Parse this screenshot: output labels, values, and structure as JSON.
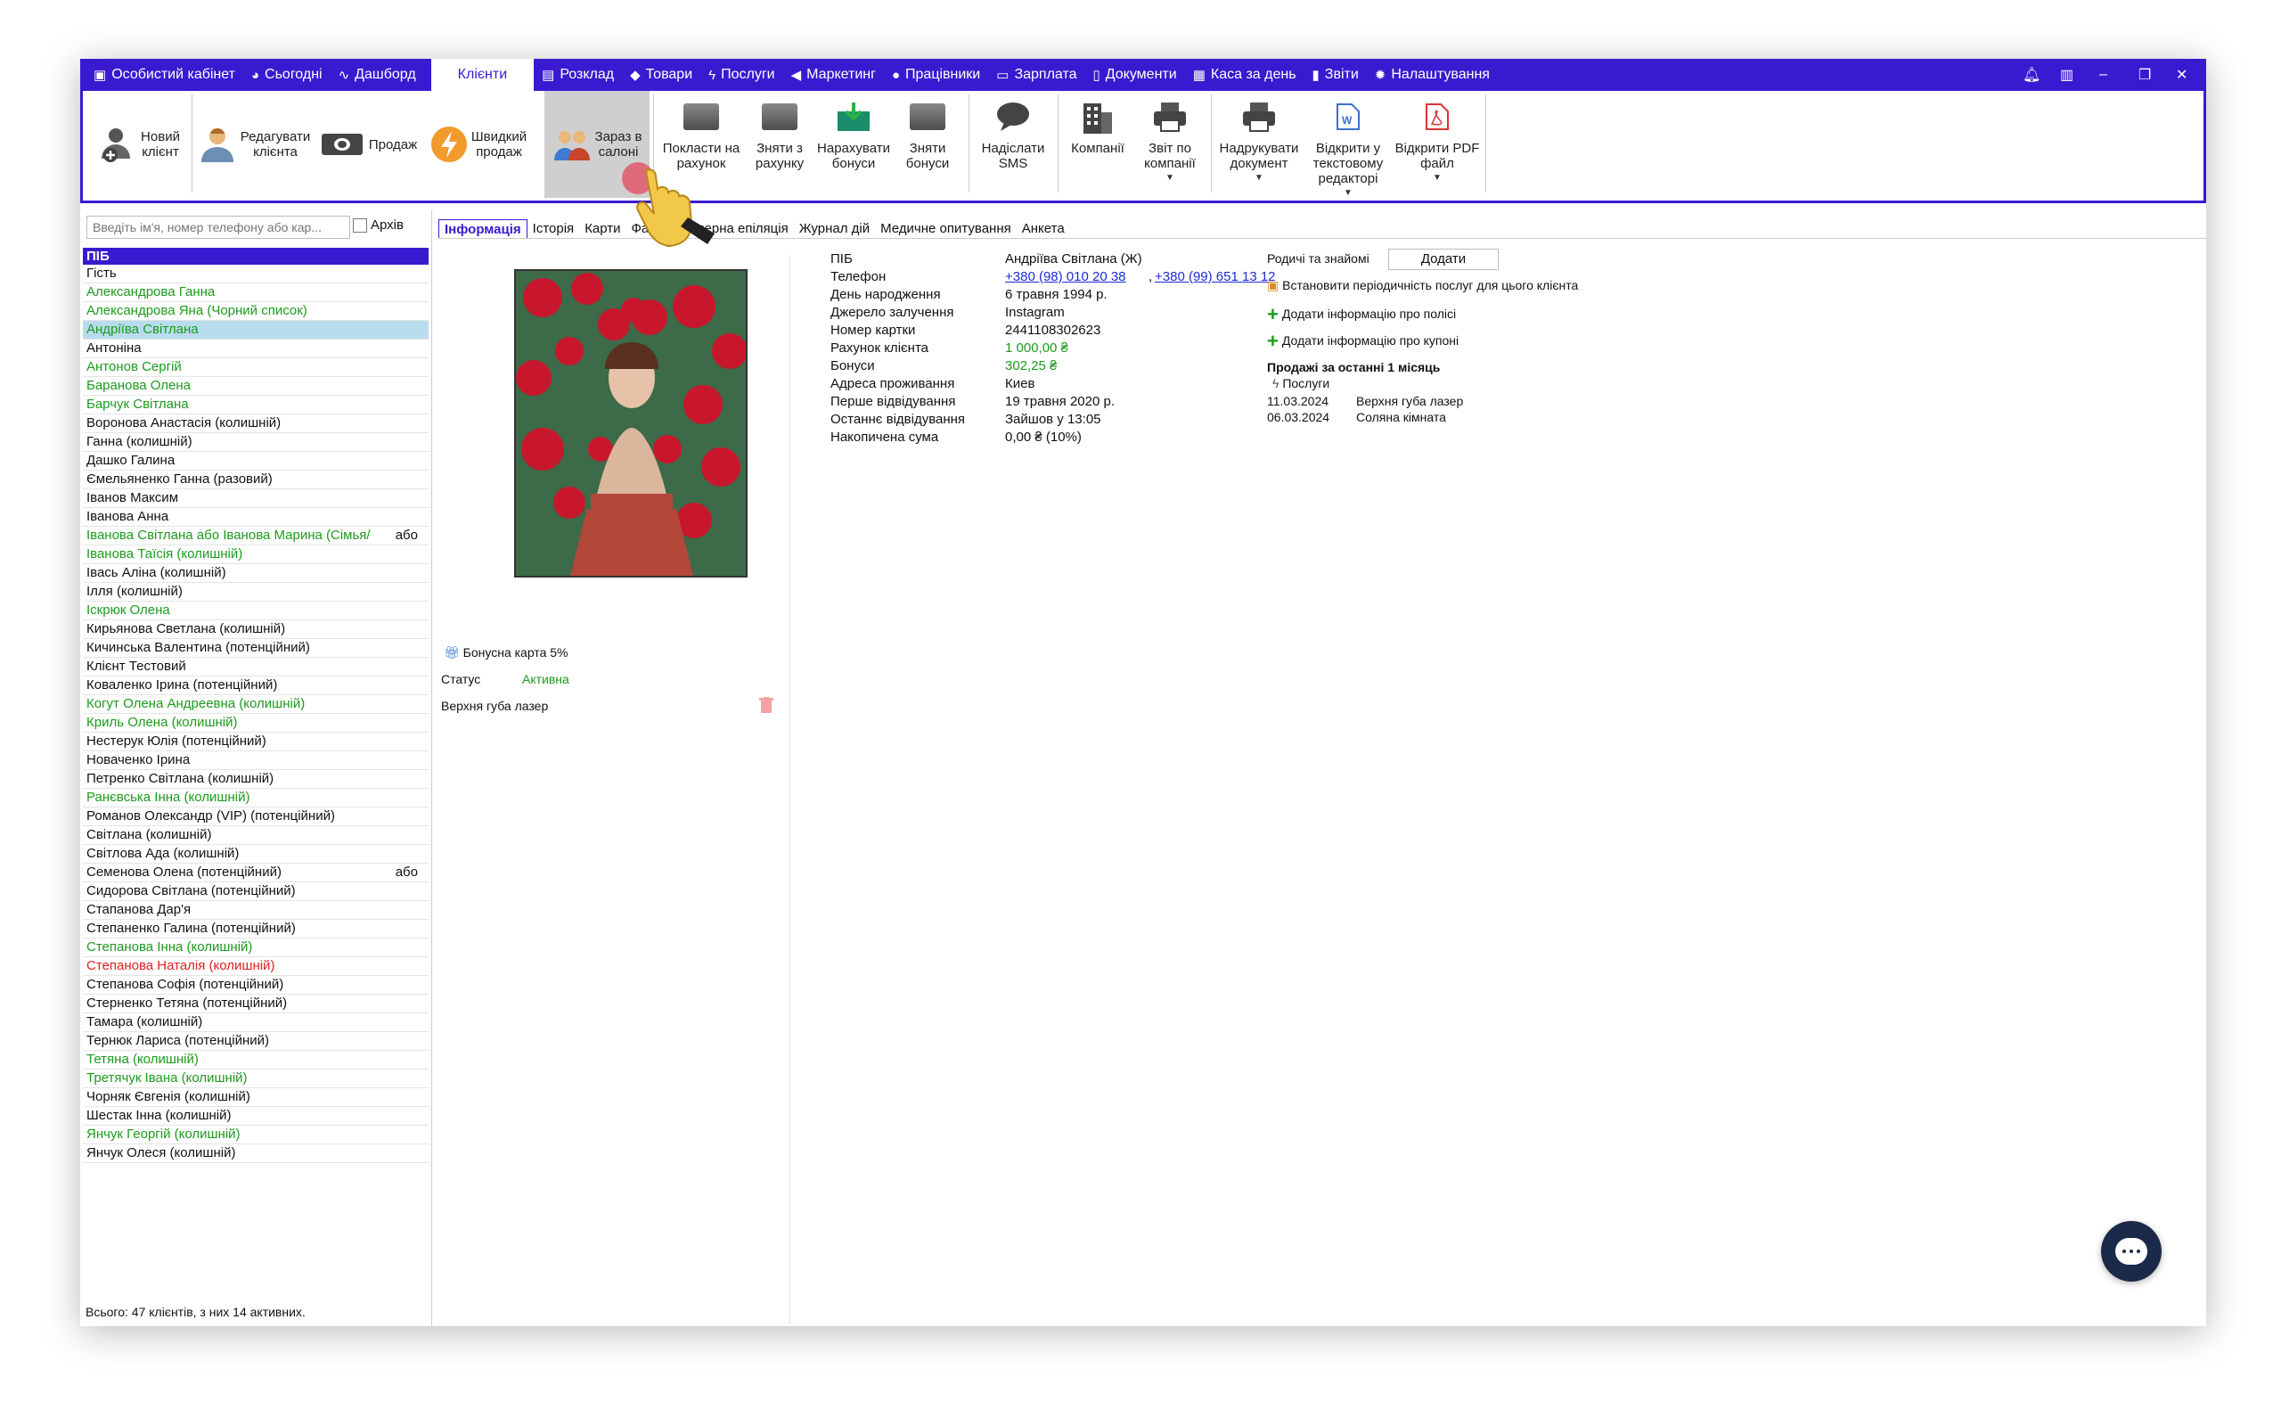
{
  "topbar": {
    "items": [
      {
        "label": "Особистий кабінет",
        "icon": "wallet-icon"
      },
      {
        "label": "Сьогодні",
        "icon": "clock-icon"
      },
      {
        "label": "Дашборд",
        "icon": "pulse-icon"
      },
      {
        "label": "Клієнти",
        "icon": "",
        "active": true
      },
      {
        "label": "Розклад",
        "icon": "calendar-icon"
      },
      {
        "label": "Товари",
        "icon": "box-icon"
      },
      {
        "label": "Послуги",
        "icon": "bolt-icon"
      },
      {
        "label": "Маркетинг",
        "icon": "megaphone-icon"
      },
      {
        "label": "Працівники",
        "icon": "person-icon"
      },
      {
        "label": "Зарплата",
        "icon": "money-icon"
      },
      {
        "label": "Документи",
        "icon": "document-icon"
      },
      {
        "label": "Каса за день",
        "icon": "calculator-icon"
      },
      {
        "label": "Звіти",
        "icon": "bar-chart-icon"
      },
      {
        "label": "Налаштування",
        "icon": "gear-icon"
      }
    ]
  },
  "ribbon": {
    "new_client": "Новий\nклієнт",
    "edit_client": "Редагувати\nклієнта",
    "sale": "Продаж",
    "quick_sale": "Швидкий\nпродаж",
    "now_in_salon": "Зараз в\nсалоні",
    "deposit": "Покласти на\nрахунок",
    "withdraw": "Зняти з\nрахунку",
    "add_bonus": "Нарахувати\nбонуси",
    "remove_bonus": "Зняти\nбонуси",
    "send_sms": "Надіслати\nSMS",
    "companies": "Компанії",
    "company_report": "Звіт по\nкомпанії",
    "print_doc": "Надрукувати\nдокумент",
    "open_text": "Відкрити у\nтекстовому\nредакторі",
    "open_pdf": "Відкрити PDF\nфайл"
  },
  "left": {
    "search_placeholder": "Введіть ім'я, номер телефону або кар...",
    "archive_label": "Архів",
    "header": "ПІБ",
    "footer": "Всього: 47 клієнтів, з них 14 активних.",
    "clients": [
      {
        "name": "Гість",
        "color": "black"
      },
      {
        "name": "Александрова Ганна",
        "color": "green"
      },
      {
        "name": "Александрова Яна (Чорний список)",
        "color": "green"
      },
      {
        "name": "Андріїва Світлана",
        "color": "green",
        "selected": true
      },
      {
        "name": "Антоніна",
        "color": "black"
      },
      {
        "name": "Антонов Сергій",
        "color": "green"
      },
      {
        "name": "Баранова Олена",
        "color": "green"
      },
      {
        "name": "Барчук Світлана",
        "color": "green"
      },
      {
        "name": "Воронова Анастасія (колишній)",
        "color": "black"
      },
      {
        "name": "Ганна (колишній)",
        "color": "black"
      },
      {
        "name": "Дашко Галина",
        "color": "black"
      },
      {
        "name": "Ємельяненко Ганна (разовий)",
        "color": "black"
      },
      {
        "name": "Іванов Максим",
        "color": "black"
      },
      {
        "name": "Іванова Анна",
        "color": "black"
      },
      {
        "name": "Іванова Світлана  або Іванова  Марина (Сімья/",
        "color": "green",
        "tag": "або"
      },
      {
        "name": "Іванова Таїсія (колишній)",
        "color": "green"
      },
      {
        "name": "Івась Аліна (колишній)",
        "color": "black"
      },
      {
        "name": "Ілля (колишній)",
        "color": "black"
      },
      {
        "name": "Іскрюк Олена",
        "color": "green"
      },
      {
        "name": "Кирьянова Светлана (колишній)",
        "color": "black"
      },
      {
        "name": "Кичинська Валентина (потенційний)",
        "color": "black"
      },
      {
        "name": "Клієнт Тестовий",
        "color": "black"
      },
      {
        "name": "Коваленко Ірина (потенційний)",
        "color": "black"
      },
      {
        "name": "Когут Олена Андреевна (колишній)",
        "color": "green"
      },
      {
        "name": "Криль Олена (колишній)",
        "color": "green"
      },
      {
        "name": "Нестерук Юлія (потенційний)",
        "color": "black"
      },
      {
        "name": "Новаченко Ірина",
        "color": "black"
      },
      {
        "name": "Петренко Світлана (колишній)",
        "color": "black"
      },
      {
        "name": "Ранєвська Інна (колишній)",
        "color": "green"
      },
      {
        "name": "Романов Олександр (VIP) (потенційний)",
        "color": "black"
      },
      {
        "name": "Світлана (колишній)",
        "color": "black"
      },
      {
        "name": "Світлова Ада (колишній)",
        "color": "black"
      },
      {
        "name": "Семенова Олена (потенційний)",
        "color": "black",
        "tag": "або"
      },
      {
        "name": "Сидорова Світлана (потенційний)",
        "color": "black"
      },
      {
        "name": "Стапанова Дар'я",
        "color": "black"
      },
      {
        "name": "Степаненко Галина (потенційний)",
        "color": "black"
      },
      {
        "name": "Степанова Інна (колишній)",
        "color": "green"
      },
      {
        "name": "Степанова Наталія (колишній)",
        "color": "red"
      },
      {
        "name": "Степанова Софія (потенційний)",
        "color": "black"
      },
      {
        "name": "Стерненко Тетяна (потенційний)",
        "color": "black"
      },
      {
        "name": "Тамара (колишній)",
        "color": "black"
      },
      {
        "name": "Тернюк Лариса (потенційний)",
        "color": "black"
      },
      {
        "name": "Тетяна (колишній)",
        "color": "green"
      },
      {
        "name": "Третячук Івана (колишній)",
        "color": "green"
      },
      {
        "name": "Чорняк Євгенія (колишній)",
        "color": "black"
      },
      {
        "name": "Шестак Інна (колишній)",
        "color": "black"
      },
      {
        "name": "Янчук Георгій (колишній)",
        "color": "green"
      },
      {
        "name": "Янчук Олеся (колишній)",
        "color": "black"
      }
    ]
  },
  "tabs": [
    "Інформація",
    "Історія",
    "Карти",
    "Файли",
    "Лазерна епіляція",
    "Журнал дій",
    "Медичне опитування",
    "Анкета"
  ],
  "bonus_card": {
    "title": "Бонусна карта 5%",
    "status_label": "Статус",
    "status_value": "Активна",
    "service": "Верхня губа лазер"
  },
  "info": {
    "rows": [
      {
        "k": "ПІБ",
        "v": "Андріїва Світлана (Ж)"
      },
      {
        "k": "Телефон",
        "v": "+380 (98) 010 20 38",
        "v2": "+380 (99) 651 13 12"
      },
      {
        "k": "День народження",
        "v": "6 травня 1994 р."
      },
      {
        "k": "Джерело залучення",
        "v": "Instagram"
      },
      {
        "k": "Номер картки",
        "v": "2441108302623"
      },
      {
        "k": "Рахунок клієнта",
        "v": "1 000,00 ₴"
      },
      {
        "k": "Бонуси",
        "v": "302,25 ₴"
      },
      {
        "k": "Адреса проживання",
        "v": "Киев"
      },
      {
        "k": "Перше відвідування",
        "v": "19 травня 2020 р."
      },
      {
        "k": "Останнє відвідування",
        "v": "Зайшов у 13:05"
      },
      {
        "k": "Накопичена сума",
        "v": "0,00 ₴ (10%)"
      }
    ]
  },
  "right": {
    "relatives_label": "Родичі та знайомі",
    "add_button": "Додати",
    "periodicity": "Встановити періодичність послуг для цього клієнта",
    "add_policy": "Додати інформацію про полісі",
    "add_coupon": "Додати інформацію про купоні",
    "sales_title": "Продажі за останні 1 місяць",
    "services_label": "Послуги",
    "sales": [
      {
        "date": "11.03.2024",
        "service": "Верхня губа лазер"
      },
      {
        "date": "06.03.2024",
        "service": "Соляна кімната"
      }
    ]
  },
  "colors": {
    "accent": "#3a1ad0",
    "green": "#1d9a1d",
    "red": "#e02020",
    "link": "#1a2bd8"
  }
}
